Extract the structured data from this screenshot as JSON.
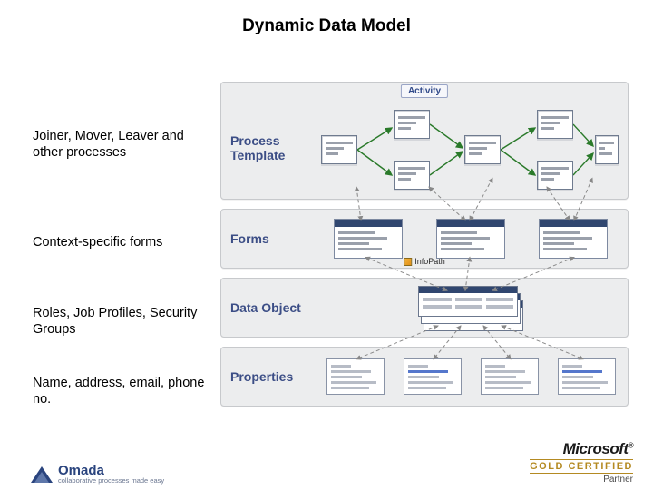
{
  "title": "Dynamic Data Model",
  "left_labels": {
    "l1": "Joiner, Mover, Leaver and other processes",
    "l2": "Context-specific forms",
    "l3": "Roles, Job Profiles, Security Groups",
    "l4": "Name, address, email, phone no."
  },
  "layers": {
    "process_template": "Process Template",
    "activity_tag": "Activity",
    "forms": "Forms",
    "data_object": "Data Object",
    "properties": "Properties"
  },
  "infopath_label": "InfoPath",
  "footer": {
    "omada_name": "Omada",
    "omada_tag": "collaborative processes made easy",
    "ms_brand": "Microsoft",
    "ms_gold": "GOLD CERTIFIED",
    "ms_partner": "Partner"
  }
}
